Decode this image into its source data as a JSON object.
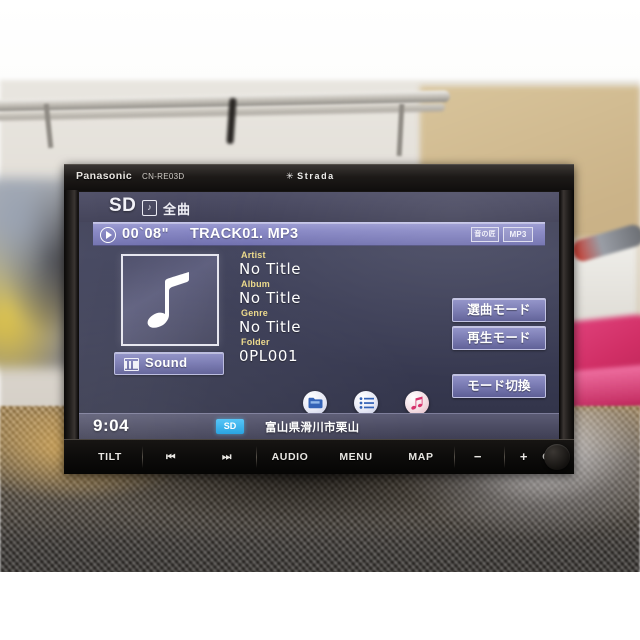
{
  "device": {
    "brand": "Panasonic",
    "model": "CN-RE03D",
    "series_logo": "Strada",
    "series_logo_star": "✳"
  },
  "screen": {
    "header": {
      "source": "SD",
      "source_icon": "music-note-box-icon",
      "mode_label": "全曲"
    },
    "track_bar": {
      "play_icon": "play-icon",
      "elapsed": "00`08\"",
      "title": "TRACK01. MP3",
      "badges": [
        {
          "name": "oto-no-takumi-badge",
          "label": "音の匠"
        },
        {
          "name": "mp3-badge",
          "label": "MP3"
        }
      ]
    },
    "album_art": {
      "icon": "music-note-icon"
    },
    "sound_button": {
      "label": "Sound",
      "icon": "equalizer-icon"
    },
    "metadata": [
      {
        "label": "Artist",
        "value": "No Title"
      },
      {
        "label": "Album",
        "value": "No Title"
      },
      {
        "label": "Genre",
        "value": "No Title"
      },
      {
        "label": "Folder",
        "value": "0PL001"
      }
    ],
    "side_buttons": [
      {
        "name": "track-select-mode-button",
        "label": "選曲モード"
      },
      {
        "name": "playback-mode-button",
        "label": "再生モード"
      },
      {
        "name": "mode-switch-button",
        "label": "モード切換"
      }
    ],
    "icon_row": [
      {
        "name": "folder-icon",
        "glyph": "folder"
      },
      {
        "name": "list-icon",
        "glyph": "list"
      },
      {
        "name": "music-note-icon",
        "glyph": "note"
      }
    ],
    "status_bar": {
      "clock": "9:04",
      "sd_indicator": "SD",
      "location": "富山県滑川市栗山"
    }
  },
  "hard_buttons": [
    {
      "name": "tilt-button",
      "label": "TILT"
    },
    {
      "name": "previous-track-button",
      "label": "⏮"
    },
    {
      "name": "next-track-button",
      "label": "⏭"
    },
    {
      "name": "audio-button",
      "label": "AUDIO"
    },
    {
      "name": "menu-button",
      "label": "MENU"
    },
    {
      "name": "map-button",
      "label": "MAP"
    },
    {
      "name": "volume-down-button",
      "label": "−"
    },
    {
      "name": "volume-up-button",
      "label": "+"
    },
    {
      "name": "opt-button",
      "label": "OPT"
    }
  ],
  "colors": {
    "lcd_bg": "#3d3f56",
    "accent_violet": "#8686c4",
    "label_yellow": "#ecd98a",
    "sd_chip": "#1f9fe0"
  }
}
